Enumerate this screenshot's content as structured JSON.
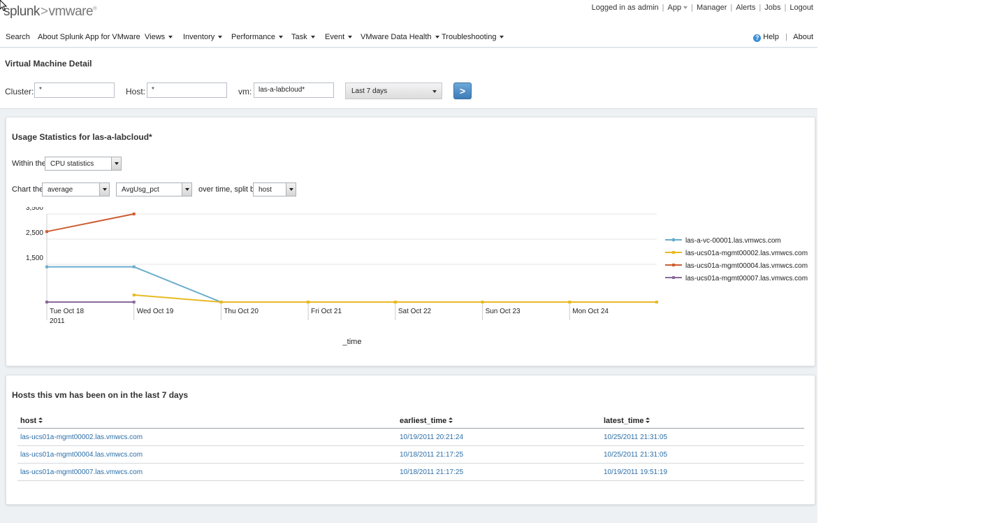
{
  "header": {
    "logo_splunk": "splunk",
    "logo_gt": ">",
    "logo_vm": "vmware",
    "account": {
      "logged_in": "Logged in as admin",
      "app": "App",
      "manager": "Manager",
      "alerts": "Alerts",
      "jobs": "Jobs",
      "logout": "Logout"
    }
  },
  "nav": {
    "items": [
      {
        "label": "Search",
        "dropdown": false
      },
      {
        "label": "About Splunk App for VMware",
        "dropdown": false
      },
      {
        "label": "Views",
        "dropdown": true
      },
      {
        "label": "Inventory",
        "dropdown": true
      },
      {
        "label": "Performance",
        "dropdown": true
      },
      {
        "label": "Task",
        "dropdown": true
      },
      {
        "label": "Event",
        "dropdown": true
      },
      {
        "label": "VMware Data Health",
        "dropdown": true
      },
      {
        "label": "Troubleshooting",
        "dropdown": true
      }
    ],
    "help": "Help",
    "about": "About"
  },
  "form": {
    "title": "Virtual Machine Detail",
    "cluster_label": "Cluster:",
    "cluster_value": "*",
    "host_label": "Host:",
    "host_value": "*",
    "vm_label": "vm:",
    "vm_value": "las-a-labcloud*",
    "time_range": "Last 7 days",
    "go_label": ">"
  },
  "usage_panel": {
    "title": "Usage Statistics for las-a-labcloud*",
    "within_label": "Within the",
    "within_value": "CPU statistics",
    "chart_label": "Chart the",
    "agg_value": "average",
    "field_value": "AvgUsg_pct",
    "over_label": "over time, split by",
    "split_value": "host"
  },
  "chart_data": {
    "type": "line",
    "x": [
      "Tue Oct 18",
      "Wed Oct 19",
      "Thu Oct 20",
      "Fri Oct 21",
      "Sat Oct 22",
      "Sun Oct 23",
      "Mon Oct 24",
      "Tue Oct 25"
    ],
    "x_tick_labels": [
      "Tue Oct 18",
      "Wed Oct 19",
      "Thu Oct 20",
      "Fri Oct 21",
      "Sat Oct 22",
      "Sun Oct 23",
      "Mon Oct 24"
    ],
    "x_year_label": "2011",
    "xlabel": "_time",
    "ylabel": "",
    "y_ticks": [
      1500,
      2500,
      3500
    ],
    "y_tick_labels": [
      "1,500",
      "2,500",
      "3,500"
    ],
    "ylim": [
      0,
      3500
    ],
    "grid": true,
    "legend_position": "right",
    "series": [
      {
        "name": "las-a-vc-00001.las.vmwcs.com",
        "color": "#6aadcc",
        "values": [
          1400,
          1400,
          0,
          0,
          0,
          0,
          0,
          0
        ]
      },
      {
        "name": "las-ucs01a-mgmt00002.las.vmwcs.com",
        "color": "#e8b923",
        "values": [
          null,
          280,
          0,
          0,
          0,
          0,
          0,
          0
        ]
      },
      {
        "name": "las-ucs01a-mgmt00004.las.vmwcs.com",
        "color": "#cc5f33",
        "values": [
          2800,
          3500,
          null,
          null,
          null,
          null,
          null,
          null
        ]
      },
      {
        "name": "las-ucs01a-mgmt00007.las.vmwcs.com",
        "color": "#8a6a9a",
        "values": [
          0,
          0,
          null,
          null,
          null,
          null,
          null,
          null
        ]
      }
    ]
  },
  "hosts_panel": {
    "title": "Hosts this vm has been on in the last 7 days",
    "columns": [
      "host",
      "earliest_time",
      "latest_time"
    ],
    "rows": [
      [
        "las-ucs01a-mgmt00002.las.vmwcs.com",
        "10/19/2011 20:21:24",
        "10/25/2011 21:31:05"
      ],
      [
        "las-ucs01a-mgmt00004.las.vmwcs.com",
        "10/18/2011 21:17:25",
        "10/25/2011 21:31:05"
      ],
      [
        "las-ucs01a-mgmt00007.las.vmwcs.com",
        "10/18/2011 21:17:25",
        "10/19/2011 19:51:19"
      ]
    ]
  }
}
